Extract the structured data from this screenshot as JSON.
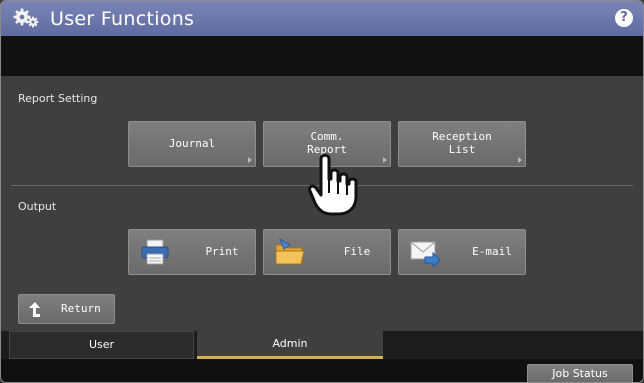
{
  "header": {
    "title": "User Functions",
    "help_label": "?"
  },
  "report_setting": {
    "label": "Report Setting",
    "buttons": [
      {
        "label": "Journal"
      },
      {
        "label": "Comm.\nReport"
      },
      {
        "label": "Reception\nList"
      }
    ]
  },
  "output": {
    "label": "Output",
    "buttons": [
      {
        "label": "Print",
        "icon": "printer-icon"
      },
      {
        "label": "File",
        "icon": "folder-icon"
      },
      {
        "label": "E-mail",
        "icon": "email-icon"
      }
    ]
  },
  "return_label": "Return",
  "tabs": [
    {
      "label": "User"
    },
    {
      "label": "Admin",
      "selected": true
    }
  ],
  "job_status_label": "Job Status",
  "colors": {
    "title_bar": "#6873a8",
    "accent_tab": "#d3b24a"
  }
}
